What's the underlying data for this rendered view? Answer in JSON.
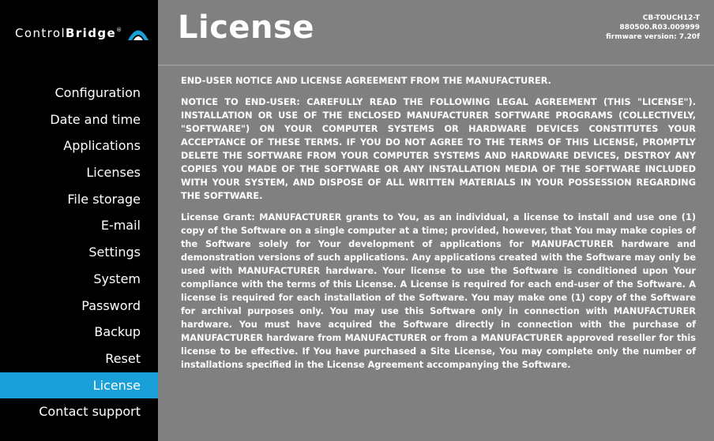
{
  "logo": {
    "control": "Control",
    "bridge": "Bridge",
    "mark": "®"
  },
  "page": {
    "title": "License"
  },
  "device": {
    "model": "CB-TOUCH12-T",
    "serial": "880500.R03.009999",
    "firmware": "firmware version: 7.20f"
  },
  "nav": [
    {
      "label": "Configuration"
    },
    {
      "label": "Date and time"
    },
    {
      "label": "Applications"
    },
    {
      "label": "Licenses"
    },
    {
      "label": "File storage"
    },
    {
      "label": "E-mail"
    },
    {
      "label": "Settings"
    },
    {
      "label": "System"
    },
    {
      "label": "Password"
    },
    {
      "label": "Backup"
    },
    {
      "label": "Reset"
    },
    {
      "label": "License"
    },
    {
      "label": "Contact support"
    }
  ],
  "license": {
    "heading": "END-USER NOTICE AND LICENSE AGREEMENT FROM THE MANUFACTURER.",
    "notice": "NOTICE TO END-USER: CAREFULLY READ THE FOLLOWING LEGAL AGREEMENT (THIS \"LICENSE\"). INSTALLATION OR USE OF THE ENCLOSED MANUFACTURER SOFTWARE PROGRAMS (COLLECTIVELY, \"SOFTWARE\") ON YOUR COMPUTER SYSTEMS OR HARDWARE DEVICES CONSTITUTES YOUR ACCEPTANCE OF THESE TERMS. IF YOU DO NOT AGREE TO THE TERMS OF THIS LICENSE, PROMPTLY DELETE THE SOFTWARE FROM YOUR COMPUTER SYSTEMS AND HARDWARE DEVICES, DESTROY ANY COPIES YOU MADE OF THE SOFTWARE OR ANY INSTALLATION MEDIA OF THE SOFTWARE INCLUDED WITH YOUR SYSTEM, AND DISPOSE OF ALL WRITTEN MATERIALS IN YOUR POSSESSION REGARDING THE SOFTWARE.",
    "grant": "License Grant: MANUFACTURER grants to You, as an individual, a license to install and use one (1) copy of the Software on a single computer at a time; provided, however, that You may make copies of the Software solely for Your development of applications for MANUFACTURER hardware and demonstration versions of such applications. Any applications created with the Software may only be used with MANUFACTURER hardware. Your license to use the Software is conditioned upon Your compliance with the terms of this License. A License is required for each end-user of the Software. A license is required for each installation of the Software. You may make one (1) copy of the Software for archival purposes only. You may use this Software only in connection with MANUFACTURER hardware. You must have acquired the Software directly in connection with the purchase of MANUFACTURER hardware from MANUFACTURER or from a MANUFACTURER approved reseller for this license to be effective. If You have purchased a Site License, You may complete only the number of installations specified in the License Agreement accompanying the Software."
  },
  "colors": {
    "sidebar_bg": "#000000",
    "main_bg": "#808080",
    "accent": "#1aa0d8",
    "text": "#ffffff"
  }
}
